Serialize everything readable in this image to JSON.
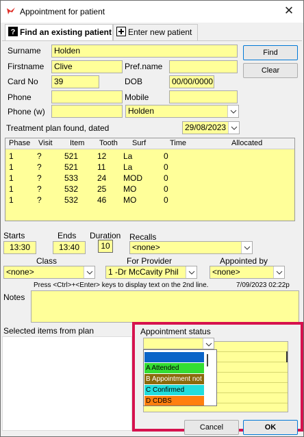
{
  "window": {
    "title": "Appointment for patient",
    "close_glyph": "✕"
  },
  "tabs": {
    "find_existing": "Find an existing patient",
    "enter_new": "Enter new patient"
  },
  "patient": {
    "surname_label": "Surname",
    "surname_value": "Holden",
    "firstname_label": "Firstname",
    "firstname_value": "Clive",
    "prefname_label": "Pref.name",
    "prefname_value": "",
    "cardno_label": "Card No",
    "cardno_value": "39",
    "dob_label": "DOB",
    "dob_value": "00/00/0000",
    "phone_label": "Phone",
    "phone_value": "",
    "mobile_label": "Mobile",
    "mobile_value": "",
    "phonew_label": "Phone (w)",
    "phonew_value": "",
    "search_combo_value": "Holden"
  },
  "buttons": {
    "find": "Find",
    "clear": "Clear",
    "cancel": "Cancel",
    "ok": "OK"
  },
  "treatment": {
    "label": "Treatment plan found, dated",
    "date_value": "29/08/2023"
  },
  "grid": {
    "headers": [
      "Phase",
      "Visit",
      "Item",
      "Tooth",
      "Surf",
      "Time",
      "Allocated"
    ],
    "rows": [
      [
        "1",
        "?",
        "521",
        "12",
        "La",
        "0",
        ""
      ],
      [
        "1",
        "?",
        "521",
        "11",
        "La",
        "0",
        ""
      ],
      [
        "1",
        "?",
        "533",
        "24",
        "MOD",
        "0",
        ""
      ],
      [
        "1",
        "?",
        "532",
        "25",
        "MO",
        "0",
        ""
      ],
      [
        "1",
        "?",
        "532",
        "46",
        "MO",
        "0",
        ""
      ]
    ]
  },
  "appointment": {
    "starts_label": "Starts",
    "starts_value": "13:30",
    "ends_label": "Ends",
    "ends_value": "13:40",
    "duration_label": "Duration",
    "duration_value": "10",
    "recalls_label": "Recalls",
    "recalls_value": "<none>",
    "class_label": "Class",
    "class_value": "<none>",
    "provider_label": "For Provider",
    "provider_value": "1 -Dr McCavity Phil",
    "appointed_label": "Appointed by",
    "appointed_value": "<none>",
    "hint_text": "Press <Ctrl>+<Enter> keys to display text on the 2nd line.",
    "timestamp": "7/09/2023 02:22p",
    "notes_label": "Notes",
    "selected_items_label": "Selected items from plan"
  },
  "status": {
    "label": "Appointment status",
    "dropdown_options": [
      {
        "label": "",
        "color": "#0a64c8"
      },
      {
        "label": "A Attended",
        "color": "#33dd33"
      },
      {
        "label": "B Appointment not",
        "color": "#8b6a0c"
      },
      {
        "label": "C Confirmed",
        "color": "#22dddd"
      },
      {
        "label": "D CDBS",
        "color": "#ff7f0f"
      }
    ]
  },
  "colors": {
    "field_bg": "#ffff99",
    "highlight_border": "#d6124e"
  },
  "icons": {
    "logo": "app-logo-icon",
    "help": "question-icon",
    "new": "new-document-icon",
    "combo": "chevron-down-icon"
  }
}
